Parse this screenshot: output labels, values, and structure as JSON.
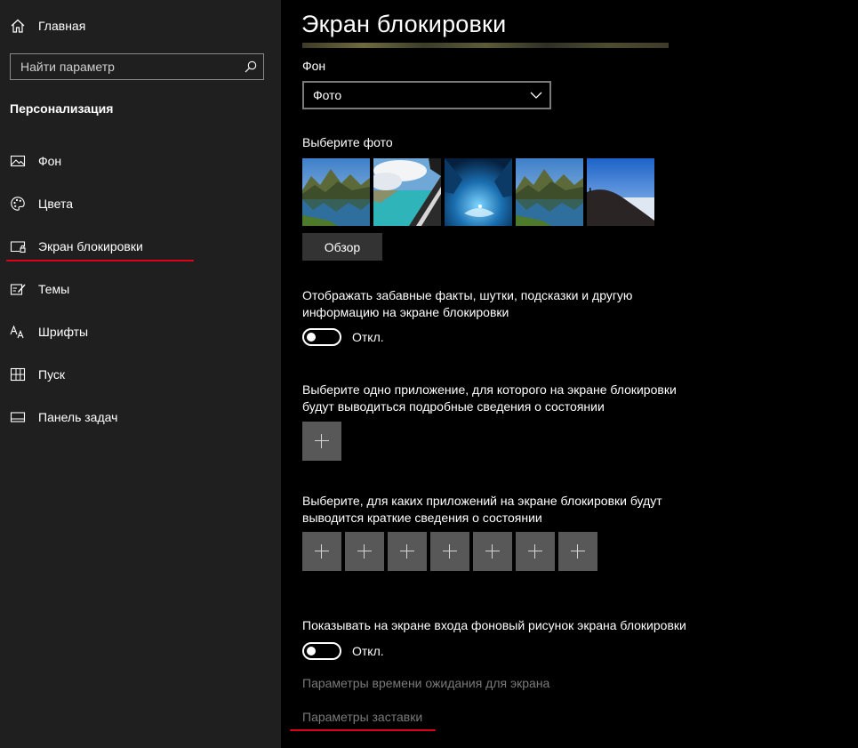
{
  "sidebar": {
    "home_label": "Главная",
    "search_placeholder": "Найти параметр",
    "section_title": "Персонализация",
    "items": [
      {
        "label": "Фон",
        "icon": "picture-icon"
      },
      {
        "label": "Цвета",
        "icon": "palette-icon"
      },
      {
        "label": "Экран блокировки",
        "icon": "lock-screen-icon"
      },
      {
        "label": "Темы",
        "icon": "themes-icon"
      },
      {
        "label": "Шрифты",
        "icon": "fonts-icon"
      },
      {
        "label": "Пуск",
        "icon": "start-icon"
      },
      {
        "label": "Панель задач",
        "icon": "taskbar-icon"
      }
    ]
  },
  "main": {
    "title": "Экран блокировки",
    "background_label": "Фон",
    "background_value": "Фото",
    "choose_photo_label": "Выберите фото",
    "browse_label": "Обзор",
    "fun_facts_label": "Отображать забавные факты, шутки, подсказки и другую информацию на экране блокировки",
    "fun_facts_toggle_state": "Откл.",
    "detailed_app_label": "Выберите одно приложение, для которого на экране блокировки будут выводиться подробные сведения о состоянии",
    "quick_apps_label": "Выберите, для каких приложений на экране блокировки будут выводится краткие сведения о состоянии",
    "quick_apps_count": 7,
    "signin_bg_label": "Показывать на экране входа фоновый рисунок экрана блокировки",
    "signin_bg_toggle_state": "Откл.",
    "screen_timeout_link": "Параметры времени ожидания для экрана",
    "screensaver_link": "Параметры заставки"
  },
  "colors": {
    "sidebar_bg": "#1f1f1f",
    "main_bg": "#000000",
    "annotation_red": "#e0001b",
    "plus_tile": "#585858",
    "button_bg": "#333333"
  }
}
